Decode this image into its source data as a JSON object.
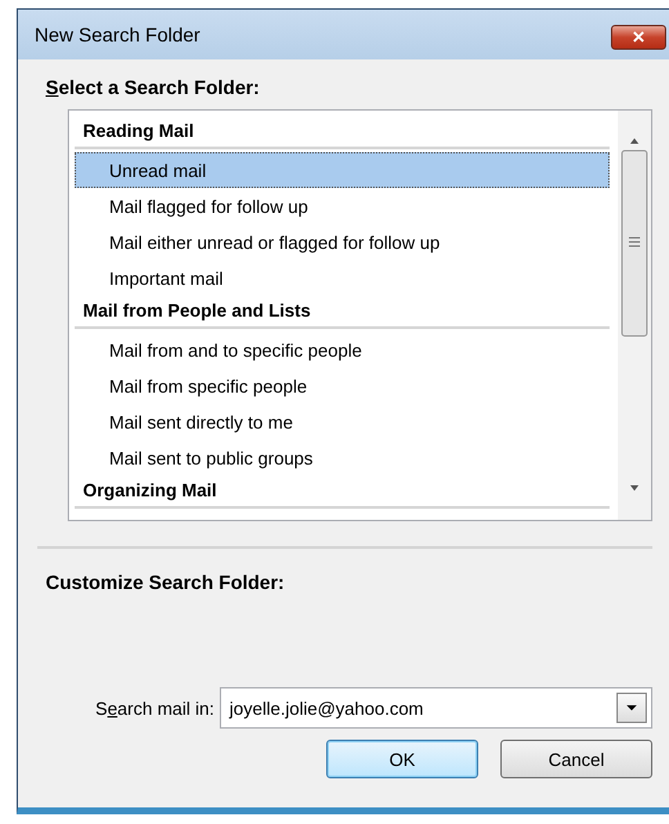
{
  "window": {
    "title": "New Search Folder",
    "close_label": "✕"
  },
  "select_label": {
    "access_key": "S",
    "after": "elect a Search Folder:"
  },
  "folder_list": [
    {
      "kind": "header",
      "label": "Reading Mail"
    },
    {
      "kind": "item",
      "label": "Unread mail",
      "selected": true
    },
    {
      "kind": "item",
      "label": "Mail flagged for follow up",
      "selected": false
    },
    {
      "kind": "item",
      "label": "Mail either unread or flagged for follow up",
      "selected": false
    },
    {
      "kind": "item",
      "label": "Important mail",
      "selected": false
    },
    {
      "kind": "header",
      "label": "Mail from People and Lists"
    },
    {
      "kind": "item",
      "label": "Mail from and to specific people",
      "selected": false
    },
    {
      "kind": "item",
      "label": "Mail from specific people",
      "selected": false
    },
    {
      "kind": "item",
      "label": "Mail sent directly to me",
      "selected": false
    },
    {
      "kind": "item",
      "label": "Mail sent to public groups",
      "selected": false
    },
    {
      "kind": "header",
      "label": "Organizing Mail"
    }
  ],
  "customize_label": "Customize Search Folder:",
  "search_in": {
    "label": {
      "before": "S",
      "access_key": "e",
      "after": "arch mail in:"
    },
    "value": "joyelle.jolie@yahoo.com"
  },
  "buttons": [
    {
      "label": "OK",
      "default": true
    },
    {
      "label": "Cancel",
      "default": false
    }
  ]
}
